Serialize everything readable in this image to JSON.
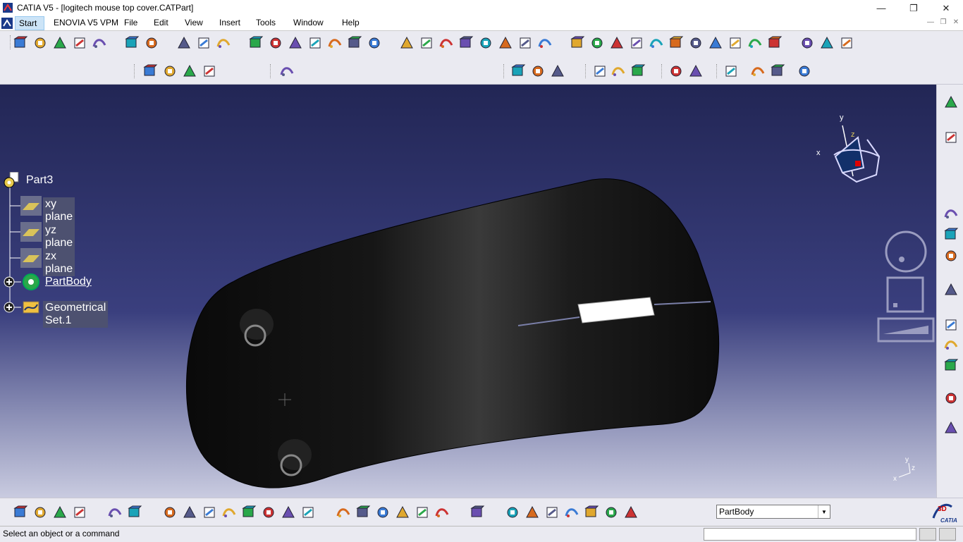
{
  "window": {
    "title": "CATIA V5 - [logitech mouse top cover.CATPart]",
    "controls": {
      "minimize": "—",
      "maximize": "❐",
      "close": "✕"
    }
  },
  "menu": {
    "items": [
      "Start",
      "ENOVIA V5 VPM",
      "File",
      "Edit",
      "View",
      "Insert",
      "Tools",
      "Window",
      "Help"
    ]
  },
  "tree": {
    "root": "Part3",
    "nodes": [
      "xy plane",
      "yz plane",
      "zx plane",
      "PartBody",
      "Geometrical Set.1"
    ]
  },
  "compass": {
    "x_label": "x",
    "y_label": "y",
    "z_label": "z"
  },
  "axis_triad": {
    "x_label": "x",
    "y_label": "y",
    "z_label": "z"
  },
  "bottom": {
    "current_body": "PartBody"
  },
  "status": {
    "message": "Select an object or a command"
  },
  "colors": {
    "viewport_top": "#222655",
    "viewport_bottom": "#c9cbe0",
    "part": "#111111",
    "toolbar": "#eaeaf1"
  },
  "icons": {
    "top_row": [
      "point-icon",
      "spline-icon",
      "curve-icon",
      "sketch-icon",
      "measure-icon",
      "measure2-icon",
      "pad-icon",
      "grid-icon",
      "constraint-icon",
      "box-icon",
      "extrude-icon",
      "yellow-box-icon",
      "slot-icon",
      "rib-icon",
      "target-icon",
      "hole-icon",
      "sweep-icon",
      "frame-icon",
      "tube-icon",
      "shell-icon",
      "surface-icon",
      "face-icon",
      "draft-icon",
      "offset-icon",
      "join-icon",
      "fit-icon",
      "pan-icon",
      "rotate-icon",
      "zoom-in-icon",
      "zoom-out-icon",
      "normal-view-icon",
      "iso-view-icon",
      "cube-view-icon",
      "render-icon",
      "hide-icon",
      "swap-icon",
      "std-view-icon",
      "mod-icon",
      "mod2-icon"
    ],
    "bottom_row": [
      "part-design-icon",
      "wireframe-icon",
      "workbench-icon",
      "color-icon",
      "new-icon",
      "open-icon",
      "save-icon",
      "print-icon",
      "cut-icon",
      "copy-icon",
      "paste-icon",
      "undo-icon",
      "redo-icon",
      "help-icon",
      "formula-icon",
      "comment-icon",
      "link-icon",
      "table-icon",
      "tree-icon",
      "catalog-icon",
      "update-icon",
      "fly-icon",
      "hand-icon",
      "axis-icon",
      "scale-icon",
      "snap-icon",
      "filter-icon",
      "layer-icon"
    ]
  }
}
